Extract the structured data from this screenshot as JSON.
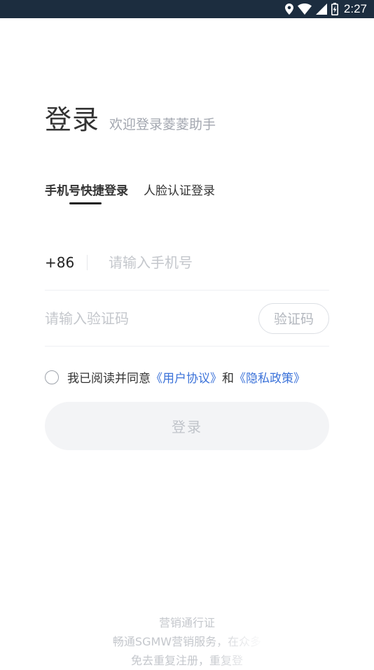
{
  "status_bar": {
    "time": "2:27",
    "icons": [
      "location-icon",
      "wifi-icon",
      "signal-icon",
      "battery-icon"
    ]
  },
  "header": {
    "title": "登录",
    "subtitle": "欢迎登录菱菱助手"
  },
  "tabs": [
    {
      "label": "手机号快捷登录",
      "active": true
    },
    {
      "label": "人脸认证登录",
      "active": false
    }
  ],
  "form": {
    "country_code": "+86",
    "phone_placeholder": "请输入手机号",
    "code_placeholder": "请输入验证码",
    "code_button": "验证码",
    "agree_prefix": "我已阅读并同意",
    "user_agreement": "《用户协议》",
    "and_text": "和",
    "privacy_policy": "《隐私政策》",
    "login_button": "登录"
  },
  "footer": {
    "title": "营销通行证",
    "line1": "畅通SGMW营销服务，在众多",
    "line2": "免去重复注册，重复登"
  },
  "colors": {
    "status_bar": "#1c2d3f",
    "link": "#3b72d9",
    "placeholder": "#c4c7cc"
  }
}
